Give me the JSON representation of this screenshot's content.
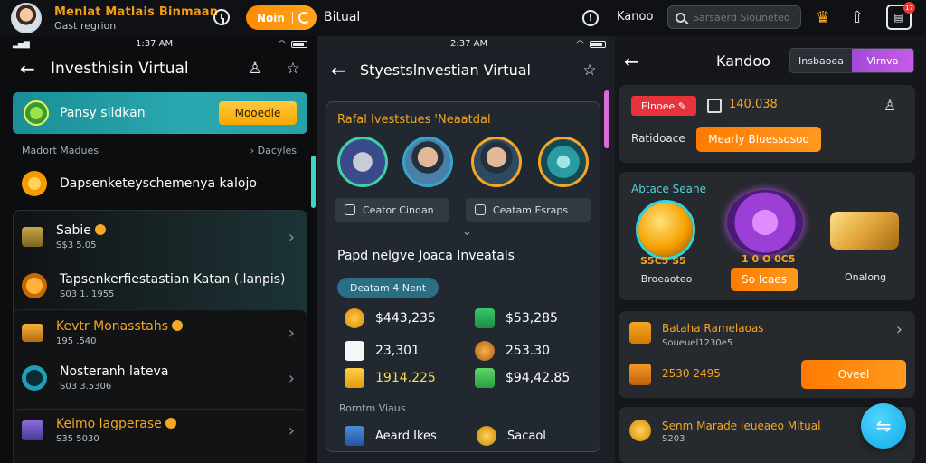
{
  "topbar": {
    "title": "Menlat Matlais Binmaan",
    "subtitle": "Oast regrion",
    "join_label": "Noin",
    "virtual_label": "Bitual",
    "name_label": "Kanoo",
    "search_placeholder": "Sarsaerd Siouneted",
    "cart_badge": "17"
  },
  "status": {
    "time1": "1:37 AM",
    "time2": "2:37 AM"
  },
  "panel1": {
    "title": "Investhisin Virtual",
    "banner_text": "Pansy slidkan",
    "banner_button": "Mooedle",
    "section_head": "Madort Madues",
    "section_more": "Dacyles",
    "rows": [
      {
        "title": "Dapsenketeyschemenya kalojo",
        "sub": ""
      },
      {
        "title": "Sabie",
        "sub": "S$3 5.05"
      },
      {
        "title": "Tapsenkerfiestastian Katan (.lanpis)",
        "sub": "S03 1. 1955"
      },
      {
        "title": "Kevtr Monasstahs",
        "sub": "195 .540"
      },
      {
        "title": "Nosteranh lateva",
        "sub": "S03 3.5306"
      },
      {
        "title": "Keimo lagperase",
        "sub": "S35 5030"
      }
    ]
  },
  "panel2": {
    "title": "Styestslnvestian Virtual",
    "card_title": "Rafal Iveststues 'Neaatdal",
    "chip_left": "Ceator Cindan",
    "chip_right": "Ceatam Esraps",
    "subtitle": "Papd nelgve Joaca Inveatals",
    "pill": "Deatam 4 Nent",
    "stats": [
      {
        "value": "$443,235"
      },
      {
        "value": "$53,285"
      },
      {
        "value": "23,301"
      },
      {
        "value": "253.30"
      },
      {
        "value": "1914.225"
      },
      {
        "value": "$94,42.85"
      }
    ],
    "footer_head": "Rorntm Viaus",
    "footer_left": "Aeard Ikes",
    "footer_right": "Sacaol"
  },
  "panel3": {
    "title": "Kandoo",
    "toggle_left": "Insbaoea",
    "toggle_right": "Virnva",
    "red_chip": "Elnoee",
    "amount": "140.038",
    "label": "Ratidoace",
    "orange_button": "Mearly Bluessosoo",
    "section_title": "Abtace Seane",
    "icon1_num": "S5C5 S5",
    "icon1_label": "Broeaoteo",
    "icon2_num": "1 0 O  0C5",
    "icon2_button": "So Icaes",
    "icon3_label": "Onalong",
    "row1_title": "Bataha Ramelaoas",
    "row1_sub": "Soueuel1230e5",
    "row1_amount": "2530 2495",
    "row1_button": "Oveel",
    "row2_title": "Senm Marade Ieueaeo Mitual",
    "row2_sub": "S203"
  },
  "colors": {
    "accent": "#f5a623",
    "teal": "#2aa8b0",
    "purple": "#b753e0",
    "cyan": "#12a9e6"
  }
}
